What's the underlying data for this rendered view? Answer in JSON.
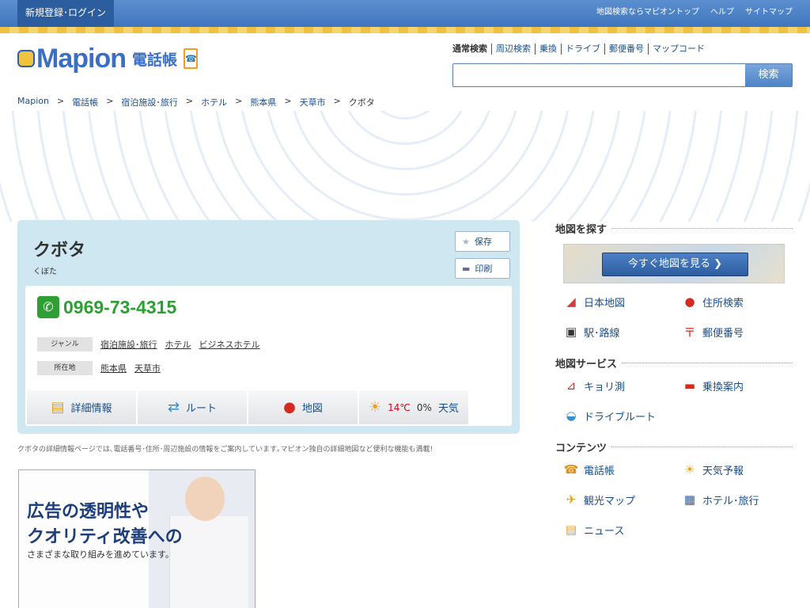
{
  "topbar": {
    "login": "新規登録･ログイン",
    "links": [
      "地図検索ならマピオントップ",
      "ヘルプ",
      "サイトマップ"
    ]
  },
  "logo": {
    "name": "Mapion",
    "sub": "電話帳"
  },
  "search": {
    "tabs": [
      "通常検索",
      "周辺検索",
      "乗換",
      "ドライブ",
      "郵便番号",
      "マップコード"
    ],
    "placeholder": "",
    "button": "検索"
  },
  "breadcrumb": [
    "Mapion",
    "電話帳",
    "宿泊施設･旅行",
    "ホテル",
    "熊本県",
    "天草市",
    "クボタ"
  ],
  "detail": {
    "name": "クボタ",
    "kana": "くぼた",
    "save": "保存",
    "print": "印刷",
    "tel": "0969-73-4315",
    "genre_label": "ジャンル",
    "genres": [
      "宿泊施設･旅行",
      "ホテル",
      "ビジネスホテル"
    ],
    "location_label": "所在地",
    "locations": [
      "熊本県",
      "天草市"
    ],
    "tiles": {
      "detail": "詳細情報",
      "route": "ルート",
      "map": "地図",
      "temp": "14℃",
      "rain": "0%",
      "weather": "天気"
    },
    "note": "クボタの詳細情報ページでは､電話番号･住所･周辺施設の情報をご案内しています｡マピオン独自の詳細地図など便利な機能も満載!"
  },
  "ad": {
    "line1": "広告の透明性や",
    "line2": "クオリティ改善への",
    "line3": "さまざまな取り組みを進めています。"
  },
  "sidebar": {
    "find_title": "地図を探す",
    "map_button": "今すぐ地図を見る ❯",
    "find_items": [
      "日本地図",
      "住所検索",
      "駅･路線",
      "郵便番号"
    ],
    "service_title": "地図サービス",
    "service_items": [
      "キョリ測",
      "乗換案内",
      "ドライブルート"
    ],
    "content_title": "コンテンツ",
    "content_items": [
      "電話帳",
      "天気予報",
      "観光マップ",
      "ホテル･旅行",
      "ニュース"
    ]
  },
  "colors": {
    "accent": "#3f76bd",
    "tel": "#2e9e35",
    "temp": "#d0021b"
  }
}
